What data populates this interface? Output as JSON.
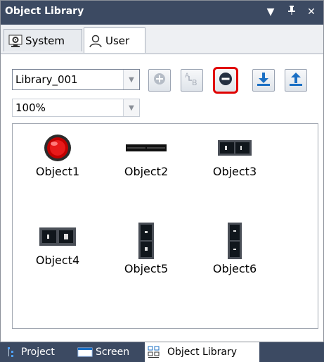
{
  "window": {
    "title": "Object Library",
    "buttons": {
      "dropdown_glyph": "▼",
      "pin_glyph": "ᛘ",
      "close_glyph": "✕"
    }
  },
  "top_tabs": [
    {
      "label": "System",
      "icon": "system-settings-icon"
    },
    {
      "label": "User",
      "icon": "user-icon",
      "active": true
    }
  ],
  "toolbar": {
    "library_select": {
      "value": "Library_001"
    },
    "zoom_select": {
      "value": "100%"
    },
    "tools": [
      {
        "name": "add-button",
        "icon": "plus-circle-icon",
        "enabled": false
      },
      {
        "name": "rename-button",
        "icon": "rename-ab-icon",
        "enabled": false
      },
      {
        "name": "remove-button",
        "icon": "minus-circle-icon",
        "enabled": true,
        "highlighted": true
      },
      {
        "name": "import-button",
        "icon": "download-icon",
        "enabled": true
      },
      {
        "name": "export-button",
        "icon": "upload-icon",
        "enabled": true
      }
    ]
  },
  "objects": [
    {
      "label": "Object1",
      "icon": "red-lamp-icon"
    },
    {
      "label": "Object2",
      "icon": "horizontal-bar-icon"
    },
    {
      "label": "Object3",
      "icon": "switch-horizontal-icon"
    },
    {
      "label": "Object4",
      "icon": "switch-panel-icon"
    },
    {
      "label": "Object5",
      "icon": "switch-vertical-icon"
    },
    {
      "label": "Object6",
      "icon": "switch-vertical-2-icon"
    }
  ],
  "bottom_tabs": [
    {
      "label": "Project",
      "icon": "project-tree-icon"
    },
    {
      "label": "Screen",
      "icon": "screen-icon"
    },
    {
      "label": "Object Library",
      "icon": "object-library-icon",
      "active": true
    }
  ],
  "colors": {
    "titlebar": "#3c4a62",
    "highlight": "#e00000",
    "accent_blue": "#1a6fc4"
  }
}
